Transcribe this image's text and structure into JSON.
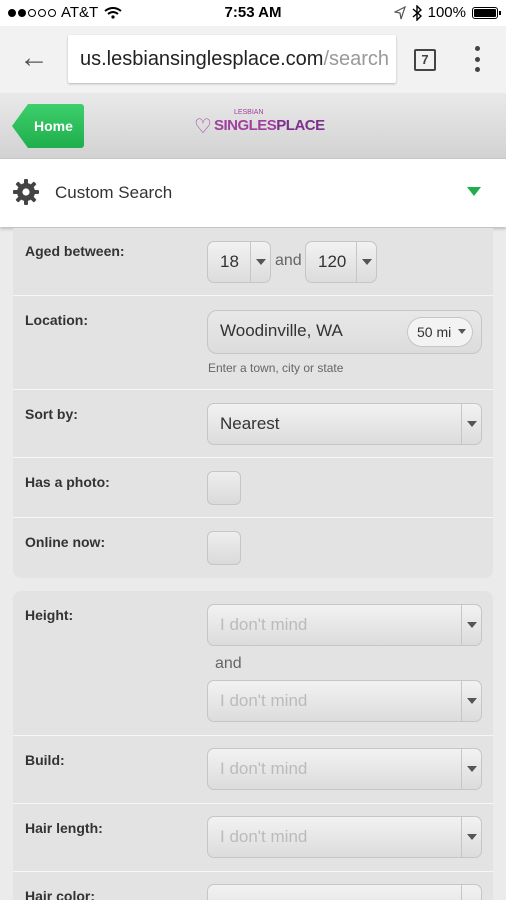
{
  "status_bar": {
    "carrier": "AT&T",
    "time": "7:53 AM",
    "battery": "100%"
  },
  "browser": {
    "url_domain": "us.lesbiansinglesplace.com",
    "url_path": "/search",
    "tab_count": "7"
  },
  "header": {
    "home_label": "Home",
    "logo_small": "LESBIAN",
    "logo_part1": "SINGLES",
    "logo_part2": "PLACE"
  },
  "search_bar": {
    "title": "Custom Search"
  },
  "form": {
    "aged_between": {
      "label": "Aged between:",
      "min": "18",
      "joiner": "and",
      "max": "120"
    },
    "location": {
      "label": "Location:",
      "value": "Woodinville, WA",
      "radius": "50 mi",
      "hint": "Enter a town, city or state"
    },
    "sort_by": {
      "label": "Sort by:",
      "value": "Nearest"
    },
    "has_photo": {
      "label": "Has a photo:"
    },
    "online_now": {
      "label": "Online now:"
    },
    "height": {
      "label": "Height:",
      "min": "I don't mind",
      "joiner": "and",
      "max": "I don't mind"
    },
    "build": {
      "label": "Build:",
      "value": "I don't mind"
    },
    "hair_length": {
      "label": "Hair length:",
      "value": "I don't mind"
    },
    "hair_color": {
      "label": "Hair color:"
    }
  }
}
